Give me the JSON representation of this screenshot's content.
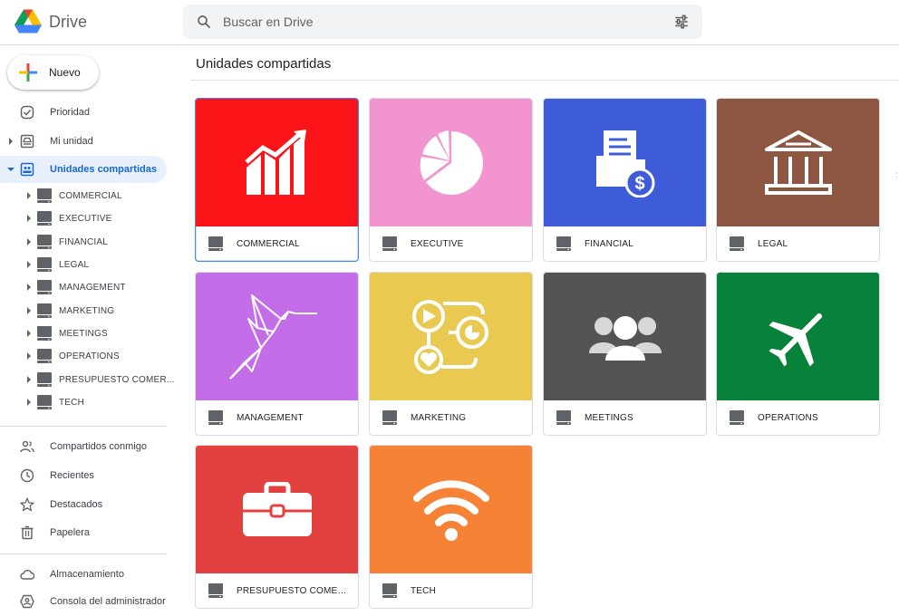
{
  "app": {
    "name": "Drive"
  },
  "search": {
    "placeholder": "Buscar en Drive"
  },
  "new_button": {
    "label": "Nuevo"
  },
  "nav": {
    "priority": "Prioridad",
    "my_drive": "Mi unidad",
    "shared_drives": "Unidades compartidas",
    "shared_with_me": "Compartidos conmigo",
    "recent": "Recientes",
    "starred": "Destacados",
    "trash": "Papelera",
    "storage": "Almacenamiento",
    "admin_console": "Consola del administrador"
  },
  "tree": [
    "COMMERCIAL",
    "EXECUTIVE",
    "FINANCIAL",
    "LEGAL",
    "MANAGEMENT",
    "MARKETING",
    "MEETINGS",
    "OPERATIONS",
    "PRESUPUESTO COMER...",
    "TECH"
  ],
  "main": {
    "title": "Unidades compartidas"
  },
  "drives": [
    {
      "name": "COMMERCIAL",
      "color": "#fa1418",
      "icon": "growth-chart-icon"
    },
    {
      "name": "EXECUTIVE",
      "color": "#f294cf",
      "icon": "pie-chart-icon"
    },
    {
      "name": "FINANCIAL",
      "color": "#3e5cd7",
      "icon": "money-folder-icon"
    },
    {
      "name": "LEGAL",
      "color": "#8d5640",
      "icon": "courthouse-icon"
    },
    {
      "name": "MANAGEMENT",
      "color": "#c46de8",
      "icon": "hummingbird-icon"
    },
    {
      "name": "MARKETING",
      "color": "#e9c94f",
      "icon": "marketing-flow-icon"
    },
    {
      "name": "MEETINGS",
      "color": "#545454",
      "icon": "people-icon"
    },
    {
      "name": "OPERATIONS",
      "color": "#08813a",
      "icon": "airplane-icon"
    },
    {
      "name": "PRESUPUESTO COMERC...",
      "color": "#e34040",
      "icon": "briefcase-icon"
    },
    {
      "name": "TECH",
      "color": "#f58235",
      "icon": "wifi-icon"
    }
  ]
}
